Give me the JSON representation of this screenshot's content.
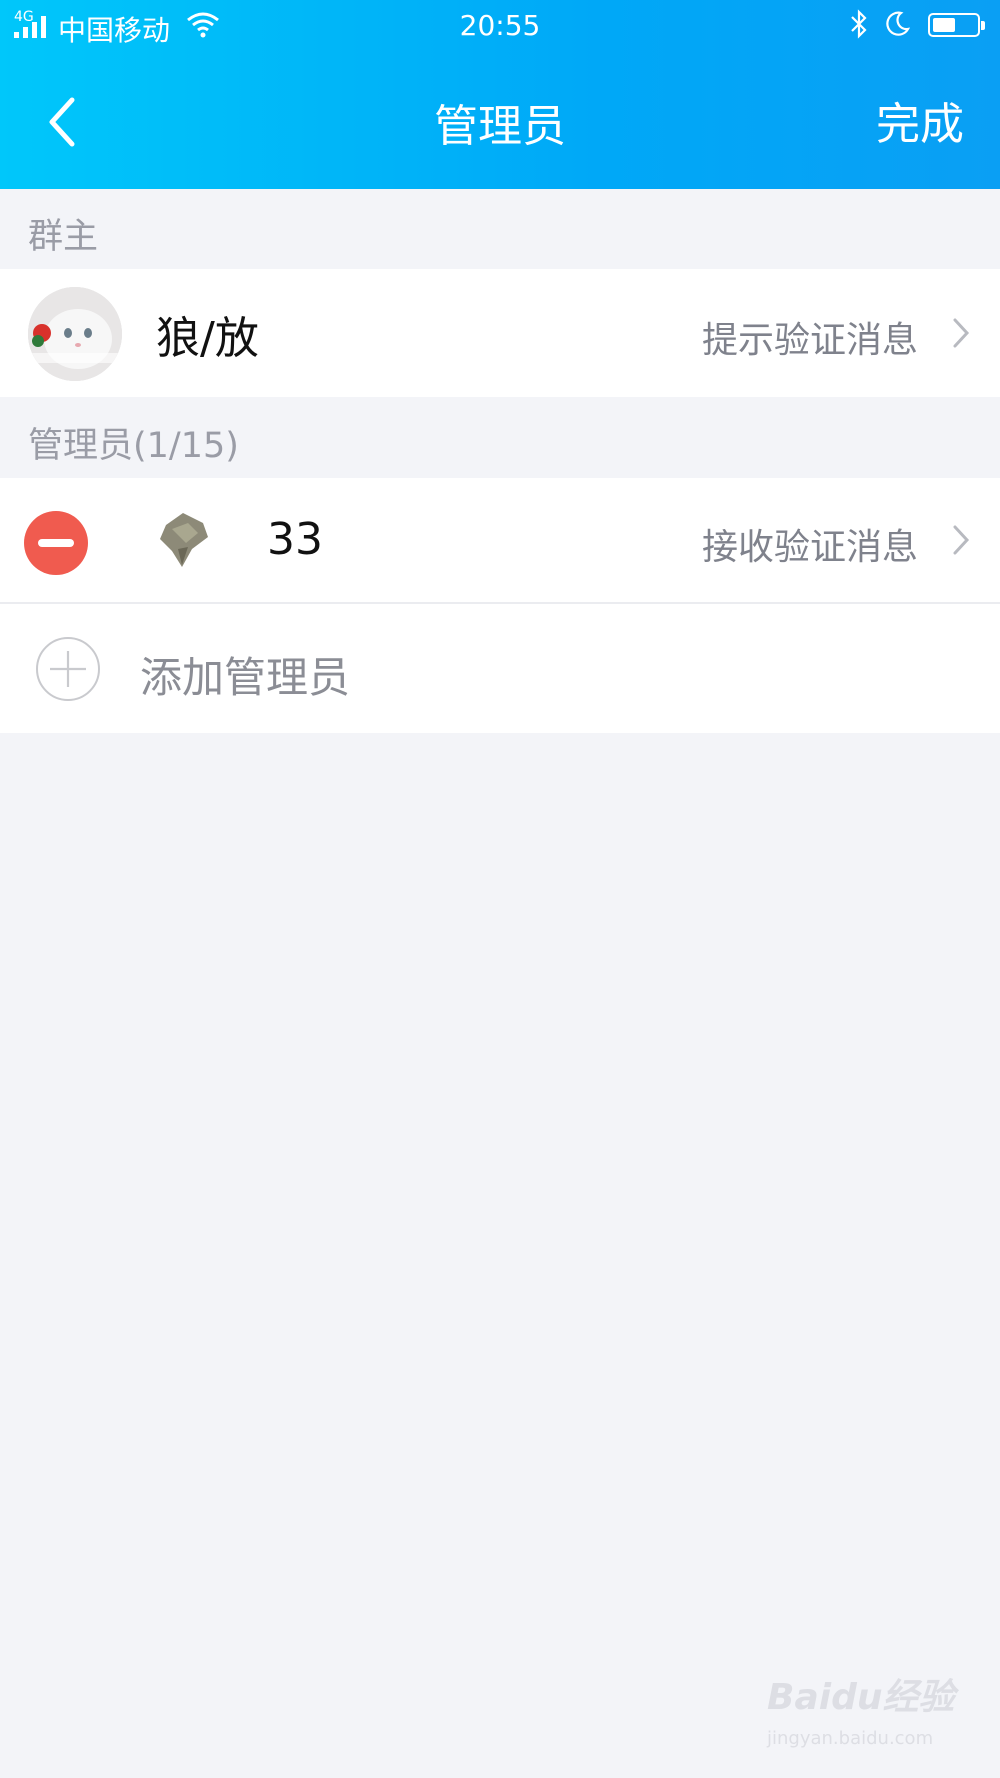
{
  "status_bar": {
    "network": "4G",
    "carrier": "中国移动",
    "time": "20:55",
    "battery_level": 0.56
  },
  "header": {
    "title": "管理员",
    "done_label": "完成",
    "color_start": "#00c7fa",
    "color_end": "#0a9ff4"
  },
  "owner_section": {
    "label": "群主",
    "owner": {
      "name": "狼/放",
      "action_text": "提示验证消息"
    }
  },
  "admin_section": {
    "label": "管理员(1/15)",
    "admins": [
      {
        "name": "33",
        "action_text": "接收验证消息"
      }
    ],
    "add_label": "添加管理员"
  },
  "watermark": {
    "text": "Baidu经验",
    "sub": "jingyan.baidu.com"
  },
  "colors": {
    "background": "#f3f4f8",
    "remove": "#f05b4f",
    "secondary_text": "#7f828c"
  }
}
